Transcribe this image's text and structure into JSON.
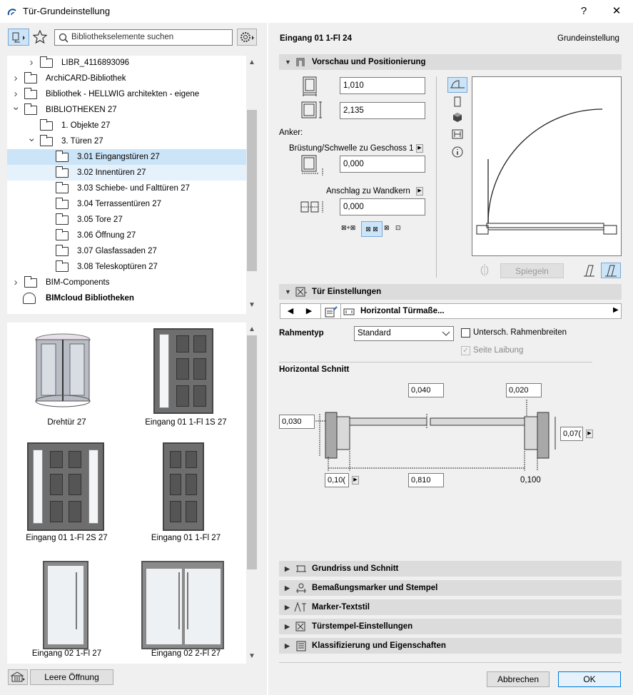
{
  "window": {
    "title": "Tür-Grundeinstellung",
    "help": "?",
    "close": "✕"
  },
  "search": {
    "placeholder": "Bibliothekselemente suchen"
  },
  "tree": [
    {
      "label": "LIBR_4116893096",
      "indent": 1,
      "chev": "right"
    },
    {
      "label": "ArchiCARD-Bibliothek",
      "indent": 0,
      "chev": "right"
    },
    {
      "label": "Bibliothek - HELLWIG architekten - eigene",
      "indent": 0,
      "chev": "right"
    },
    {
      "label": "BIBLIOTHEKEN 27",
      "indent": 0,
      "chev": "down"
    },
    {
      "label": "1. Objekte 27",
      "indent": 1,
      "chev": ""
    },
    {
      "label": "3. Türen 27",
      "indent": 1,
      "chev": "down"
    },
    {
      "label": "3.01 Eingangstüren 27",
      "indent": 2,
      "chev": "",
      "state": "sel"
    },
    {
      "label": "3.02 Innentüren 27",
      "indent": 2,
      "chev": "",
      "state": "sel2"
    },
    {
      "label": "3.03 Schiebe- und Falttüren 27",
      "indent": 2,
      "chev": ""
    },
    {
      "label": "3.04 Terrassentüren 27",
      "indent": 2,
      "chev": ""
    },
    {
      "label": "3.05 Tore 27",
      "indent": 2,
      "chev": ""
    },
    {
      "label": "3.06 Öffnung 27",
      "indent": 2,
      "chev": ""
    },
    {
      "label": "3.07 Glasfassaden 27",
      "indent": 2,
      "chev": ""
    },
    {
      "label": "3.08 Teleskoptüren 27",
      "indent": 2,
      "chev": ""
    },
    {
      "label": "BIM-Components",
      "indent": 0,
      "chev": "right"
    },
    {
      "label": "BIMcloud Bibliotheken",
      "indent": 0,
      "chev": "",
      "bold": true
    }
  ],
  "grid_items": [
    "Drehtür 27",
    "Eingang 01 1-Fl 1S 27",
    "Eingang 01 1-Fl 2S 27",
    "Eingang 01 1-Fl 27",
    "Eingang 02 1-Fl 27",
    "Eingang 02 2-Fl 27"
  ],
  "empty_opening_button": "Leere Öffnung",
  "header": {
    "element_name": "Eingang 01 1-Fl 24",
    "mode": "Grundeinstellung"
  },
  "sections": {
    "preview": "Vorschau und Positionierung",
    "door_settings": "Tür Einstellungen",
    "floorplan": "Grundriss und Schnitt",
    "dim_markers": "Bemaßungsmarker und Stempel",
    "marker_text": "Marker-Textstil",
    "door_stamp": "Türstempel-Einstellungen",
    "classification": "Klassifizierung und Eigenschaften"
  },
  "preview": {
    "width": "1,010",
    "height": "2,135",
    "anchor_label": "Anker:",
    "sill_label": "Brüstung/Schwelle zu Geschoss 1",
    "sill_value": "0,000",
    "reveal_label": "Anschlag zu Wandkern",
    "reveal_value": "0,000",
    "mirror_button": "Spiegeln"
  },
  "door_settings": {
    "page_title": "Horizontal Türmaße...",
    "frame_type_label": "Rahmentyp",
    "frame_type_value": "Standard",
    "diff_frame_widths": "Untersch. Rahmenbreiten",
    "side_reveal": "Seite Laibung",
    "hsection_title": "Horizontal Schnitt",
    "dims": {
      "top_mid": "0,040",
      "top_right": "0,020",
      "left": "0,030",
      "right": "0,07(",
      "bottom_left": "0,10(",
      "bottom_mid": "0,810",
      "bottom_right": "0,100"
    }
  },
  "footer": {
    "cancel": "Abbrechen",
    "ok": "OK"
  }
}
